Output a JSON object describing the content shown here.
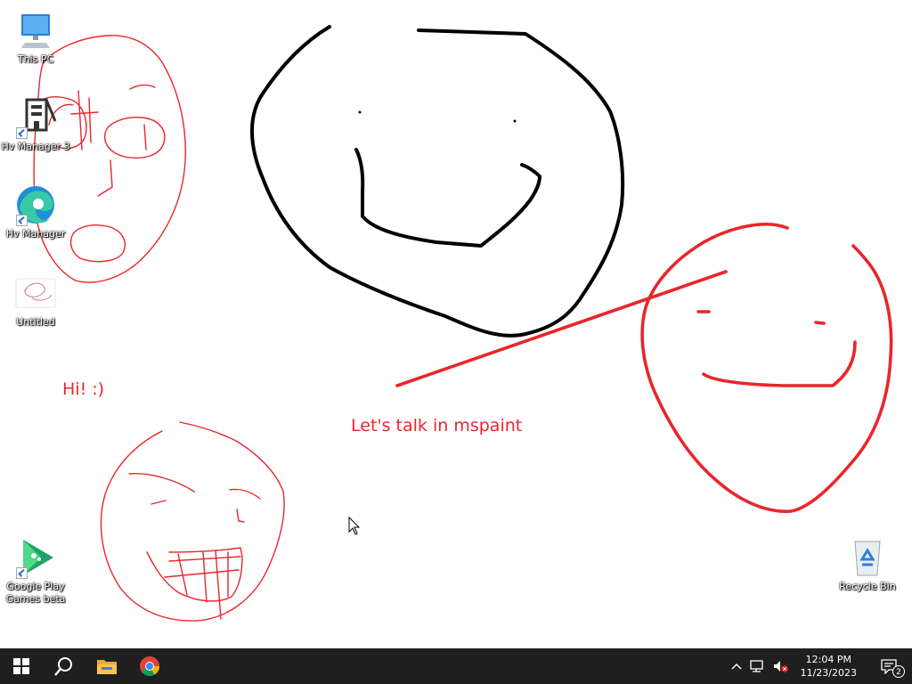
{
  "desktop": {
    "icons": [
      {
        "label": "This PC"
      },
      {
        "label": "Hv Manager 3"
      },
      {
        "label": "Hv Manager"
      },
      {
        "label": "Untitled"
      },
      {
        "label": "Google Play Games beta"
      },
      {
        "label": "Recycle Bin"
      }
    ]
  },
  "canvas": {
    "texts": [
      {
        "text": "Hi! :)"
      },
      {
        "text": "Let's talk in mspaint"
      }
    ],
    "colors": {
      "red": "#e8262c",
      "black": "#000000"
    }
  },
  "taskbar": {
    "apps": [
      "start-icon",
      "search-icon",
      "file-explorer-icon",
      "chrome-icon"
    ],
    "clock": {
      "time": "12:04 PM",
      "date": "11/23/2023"
    },
    "notifications": {
      "count": "2"
    }
  }
}
